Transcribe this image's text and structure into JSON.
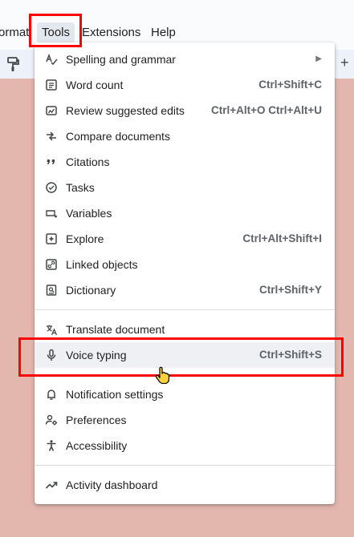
{
  "menubar": {
    "items": [
      "ormat",
      "Tools",
      "Extensions",
      "Help"
    ]
  },
  "tools_menu": {
    "groups": [
      [
        {
          "label": "Spelling and grammar",
          "shortcut": "",
          "submenu": true,
          "icon": "spellcheck-icon"
        },
        {
          "label": "Word count",
          "shortcut": "Ctrl+Shift+C",
          "icon": "word-count-icon"
        },
        {
          "label": "Review suggested edits",
          "shortcut": "Ctrl+Alt+O Ctrl+Alt+U",
          "icon": "review-edits-icon"
        },
        {
          "label": "Compare documents",
          "shortcut": "",
          "icon": "compare-icon"
        },
        {
          "label": "Citations",
          "shortcut": "",
          "icon": "quote-icon"
        },
        {
          "label": "Tasks",
          "shortcut": "",
          "icon": "tasks-icon"
        },
        {
          "label": "Variables",
          "shortcut": "",
          "icon": "variables-icon"
        },
        {
          "label": "Explore",
          "shortcut": "Ctrl+Alt+Shift+I",
          "icon": "explore-icon"
        },
        {
          "label": "Linked objects",
          "shortcut": "",
          "icon": "linked-objects-icon"
        },
        {
          "label": "Dictionary",
          "shortcut": "Ctrl+Shift+Y",
          "icon": "dictionary-icon"
        }
      ],
      [
        {
          "label": "Translate document",
          "shortcut": "",
          "icon": "translate-icon"
        },
        {
          "label": "Voice typing",
          "shortcut": "Ctrl+Shift+S",
          "icon": "microphone-icon",
          "active": true
        }
      ],
      [
        {
          "label": "Notification settings",
          "shortcut": "",
          "icon": "bell-icon"
        },
        {
          "label": "Preferences",
          "shortcut": "",
          "icon": "preferences-icon"
        },
        {
          "label": "Accessibility",
          "shortcut": "",
          "icon": "accessibility-icon"
        }
      ],
      [
        {
          "label": "Activity dashboard",
          "shortcut": "",
          "icon": "trending-icon"
        }
      ]
    ]
  },
  "colors": {
    "highlight": "#ff0000",
    "page_background": "#e4b7ae",
    "active_item": "#eef0f3"
  }
}
